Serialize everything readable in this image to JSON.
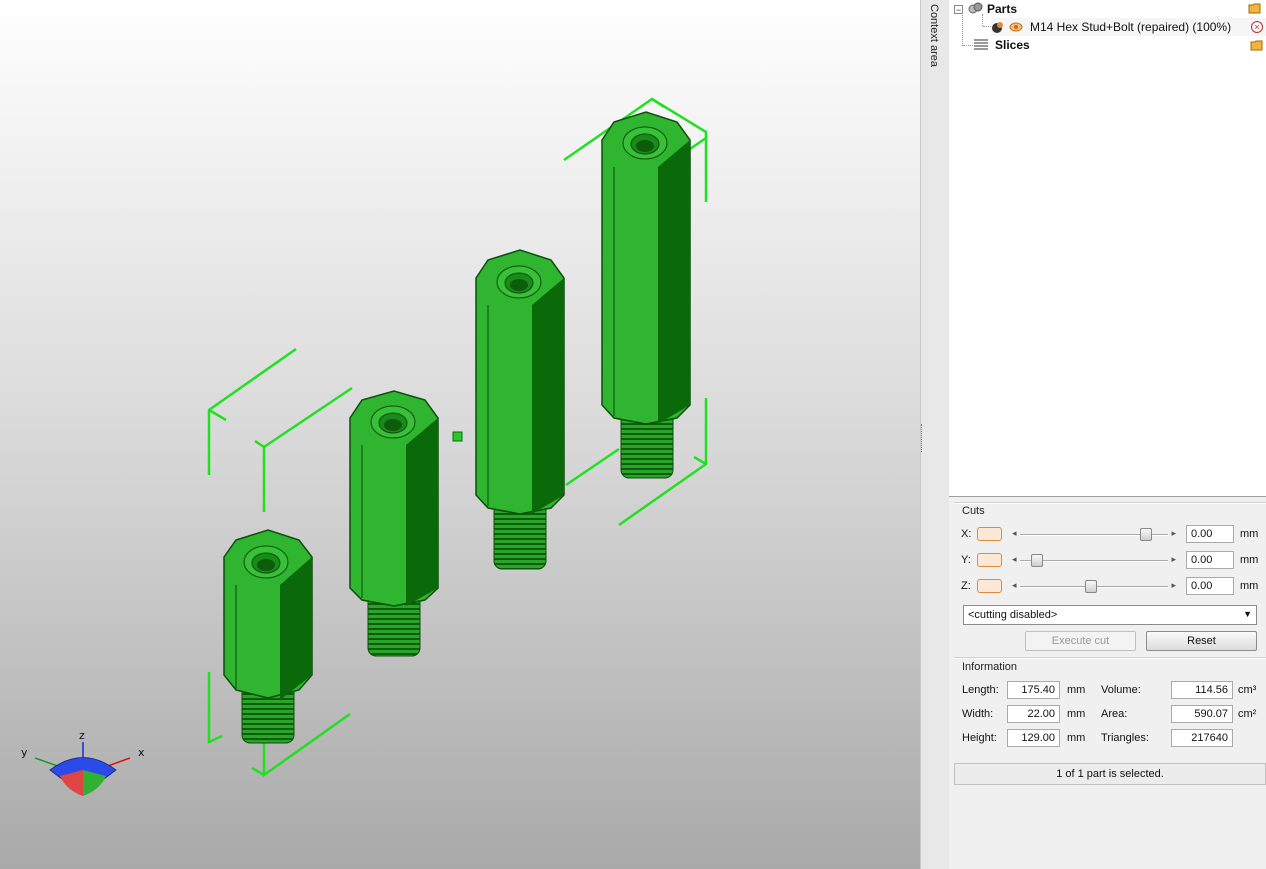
{
  "context_label": "Context area",
  "tree": {
    "parts_label": "Parts",
    "part_name": "M14 Hex Stud+Bolt (repaired) (100%)",
    "slices_label": "Slices"
  },
  "cuts": {
    "title": "Cuts",
    "axes": [
      {
        "label": "X:",
        "value": "0.00",
        "unit": "mm",
        "slider_fraction": 0.88
      },
      {
        "label": "Y:",
        "value": "0.00",
        "unit": "mm",
        "slider_fraction": 0.08
      },
      {
        "label": "Z:",
        "value": "0.00",
        "unit": "mm",
        "slider_fraction": 0.48
      }
    ],
    "mode": "<cutting disabled>",
    "execute_label": "Execute cut",
    "reset_label": "Reset"
  },
  "information": {
    "title": "Information",
    "length_label": "Length:",
    "length_value": "175.40",
    "length_unit": "mm",
    "width_label": "Width:",
    "width_value": "22.00",
    "width_unit": "mm",
    "height_label": "Height:",
    "height_value": "129.00",
    "height_unit": "mm",
    "volume_label": "Volume:",
    "volume_value": "114.56",
    "volume_unit": "cm³",
    "area_label": "Area:",
    "area_value": "590.07",
    "area_unit": "cm²",
    "triangles_label": "Triangles:",
    "triangles_value": "217640"
  },
  "status": "1 of 1 part is selected.",
  "axis_gizmo": {
    "x": "x",
    "y": "y",
    "z": "z"
  },
  "colors": {
    "part": "#2fb52f",
    "part_dark": "#0a6a0a",
    "bbox": "#21e021"
  }
}
